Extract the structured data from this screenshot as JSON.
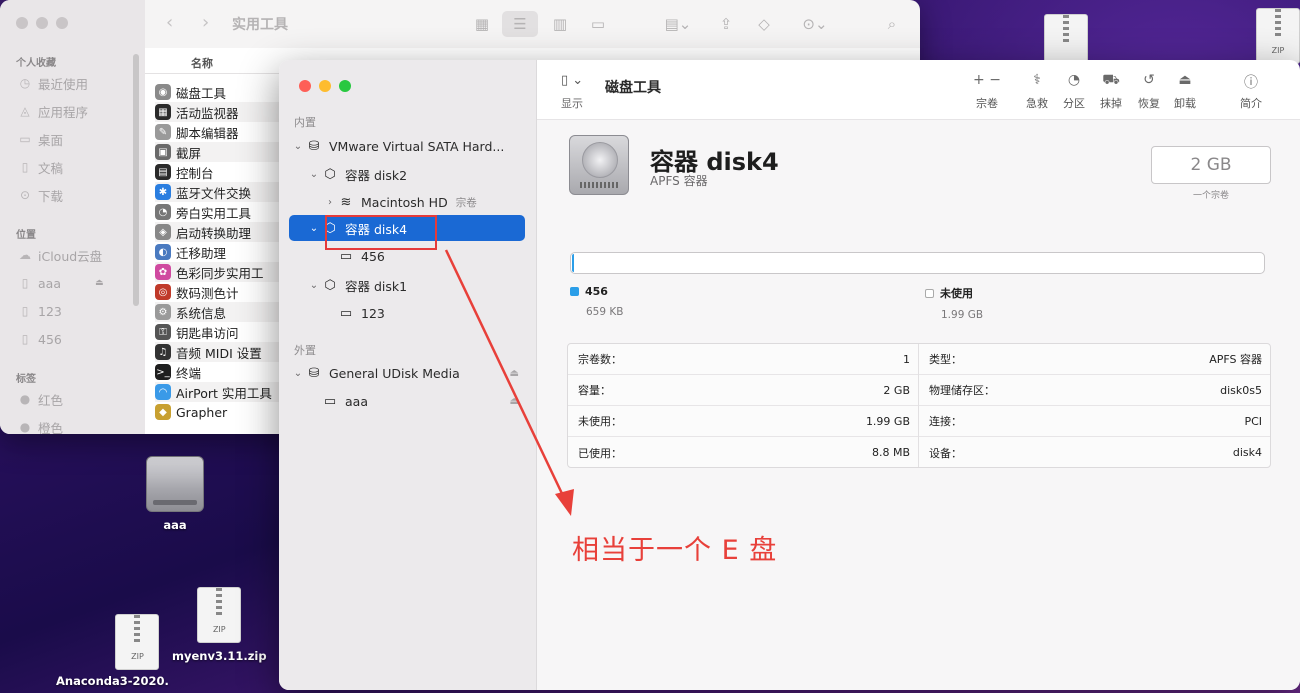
{
  "finder": {
    "title": "实用工具",
    "sidebar": {
      "favorites_header": "个人收藏",
      "favorites": [
        {
          "label": "最近使用",
          "icon": "clock-icon"
        },
        {
          "label": "应用程序",
          "icon": "apps-icon"
        },
        {
          "label": "桌面",
          "icon": "desktop-icon"
        },
        {
          "label": "文稿",
          "icon": "document-icon"
        },
        {
          "label": "下载",
          "icon": "download-icon"
        }
      ],
      "locations_header": "位置",
      "locations": [
        {
          "label": "iCloud云盘",
          "icon": "cloud-icon"
        },
        {
          "label": "aaa",
          "icon": "disk-icon"
        },
        {
          "label": "123",
          "icon": "disk-icon"
        },
        {
          "label": "456",
          "icon": "disk-icon"
        }
      ],
      "tags_header": "标签",
      "tags": [
        {
          "label": "红色",
          "color": "#b9b6b8"
        },
        {
          "label": "橙色",
          "color": "#b9b6b8"
        }
      ]
    },
    "column_header": "名称",
    "apps": [
      {
        "label": "磁盘工具",
        "color": "#8a8a8a",
        "glyph": "◉"
      },
      {
        "label": "活动监视器",
        "color": "#2b2b2b",
        "glyph": "▦"
      },
      {
        "label": "脚本编辑器",
        "color": "#9a9a9a",
        "glyph": "✎"
      },
      {
        "label": "截屏",
        "color": "#6a6a6a",
        "glyph": "▣"
      },
      {
        "label": "控制台",
        "color": "#2a2a2a",
        "glyph": "▤"
      },
      {
        "label": "蓝牙文件交换",
        "color": "#2a7ee0",
        "glyph": "✱"
      },
      {
        "label": "旁白实用工具",
        "color": "#777",
        "glyph": "◔"
      },
      {
        "label": "启动转换助理",
        "color": "#888",
        "glyph": "◈"
      },
      {
        "label": "迁移助理",
        "color": "#4a7ac0",
        "glyph": "◐"
      },
      {
        "label": "色彩同步实用工",
        "color": "#d04aa0",
        "glyph": "✿"
      },
      {
        "label": "数码测色计",
        "color": "#c03a2a",
        "glyph": "◎"
      },
      {
        "label": "系统信息",
        "color": "#9a9a9a",
        "glyph": "⚙"
      },
      {
        "label": "钥匙串访问",
        "color": "#555",
        "glyph": "⚿"
      },
      {
        "label": "音频 MIDI 设置",
        "color": "#333",
        "glyph": "♫"
      },
      {
        "label": "终端",
        "color": "#1e1e1e",
        "glyph": ">_"
      },
      {
        "label": "AirPort 实用工具",
        "color": "#3a9ae8",
        "glyph": "◠"
      },
      {
        "label": "Grapher",
        "color": "#c8a030",
        "glyph": "◆"
      }
    ]
  },
  "disk_utility": {
    "sidebar": {
      "internal_header": "内置",
      "external_header": "外置",
      "tree": [
        {
          "label": "VMware Virtual SATA Hard...",
          "icon": "drive-icon",
          "chevron": "⌄",
          "indent": 0
        },
        {
          "label": "容器 disk2",
          "icon": "container-icon",
          "chevron": "⌄",
          "indent": 1
        },
        {
          "label": "Macintosh HD",
          "sub": "宗卷",
          "icon": "stack-icon",
          "chevron": "›",
          "indent": 2
        },
        {
          "label": "容器 disk4",
          "icon": "container-icon",
          "chevron": "⌄",
          "indent": 1,
          "selected": true
        },
        {
          "label": "456",
          "icon": "volume-icon",
          "chevron": "",
          "indent": 2
        },
        {
          "label": "容器 disk1",
          "icon": "container-icon",
          "chevron": "⌄",
          "indent": 1
        },
        {
          "label": "123",
          "icon": "volume-icon",
          "chevron": "",
          "indent": 2
        },
        {
          "label": "General UDisk Media",
          "icon": "drive-icon",
          "chevron": "⌄",
          "indent": 0,
          "eject": true
        },
        {
          "label": "aaa",
          "icon": "volume-icon",
          "chevron": "",
          "indent": 1,
          "eject": true
        }
      ]
    },
    "toolbar": {
      "view_label": "显示",
      "title": "磁盘工具",
      "tools": [
        {
          "label": "宗卷",
          "glyph": "+ −",
          "name": "volume-button"
        },
        {
          "label": "急救",
          "glyph": "⚕",
          "name": "first-aid-button"
        },
        {
          "label": "分区",
          "glyph": "◔",
          "name": "partition-button"
        },
        {
          "label": "抹掉",
          "glyph": "⛟",
          "name": "erase-button"
        },
        {
          "label": "恢复",
          "glyph": "↺",
          "name": "restore-button"
        },
        {
          "label": "卸载",
          "glyph": "⏏",
          "name": "unmount-button"
        },
        {
          "label": "简介",
          "glyph": "ⓘ",
          "name": "info-button"
        }
      ]
    },
    "disk": {
      "name": "容器 disk4",
      "type": "APFS 容器",
      "size": "2 GB",
      "size_caption": "一个宗卷"
    },
    "usage": {
      "used_fraction": 0.0003,
      "used_color": "#2b9ee8",
      "items": [
        {
          "name": "456",
          "value": "659 KB",
          "color": "#2b9ee8"
        },
        {
          "name": "未使用",
          "value": "1.99 GB",
          "color": "#ffffff"
        }
      ]
    },
    "info": {
      "left": [
        {
          "key": "宗卷数：",
          "value": "1"
        },
        {
          "key": "容量：",
          "value": "2 GB"
        },
        {
          "key": "未使用：",
          "value": "1.99 GB"
        },
        {
          "key": "已使用：",
          "value": "8.8 MB"
        }
      ],
      "right": [
        {
          "key": "类型：",
          "value": "APFS 容器"
        },
        {
          "key": "物理储存区：",
          "value": "disk0s5"
        },
        {
          "key": "连接：",
          "value": "PCI"
        },
        {
          "key": "设备：",
          "value": "disk4"
        }
      ]
    }
  },
  "annotation": {
    "text": "相当于一个 E 盘",
    "color": "#e8403a"
  },
  "desktop": {
    "icons": [
      {
        "label": "aaa",
        "kind": "disk"
      },
      {
        "label": "myenv3.11.zip",
        "kind": "zip"
      },
      {
        "label": "Anaconda3-2020.",
        "kind": "zip"
      }
    ],
    "zip_caption": "ZIP"
  }
}
